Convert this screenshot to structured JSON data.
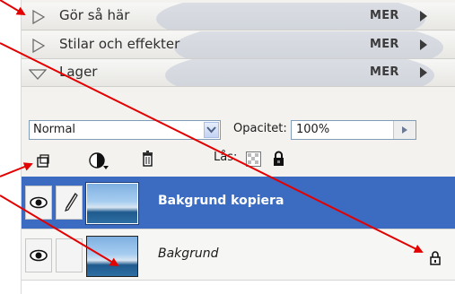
{
  "panels": [
    {
      "title": "Gör så här",
      "more": "MER"
    },
    {
      "title": "Stilar och effekter",
      "more": "MER"
    },
    {
      "title": "Lager",
      "more": "MER"
    }
  ],
  "layer_options": {
    "blend_mode": "Normal",
    "opacity_label": "Opacitet:",
    "opacity_value": "100%",
    "lock_label": "Lås:"
  },
  "layers": [
    {
      "name": "Bakgrund kopiera",
      "selected": true
    },
    {
      "name": "Bakgrund",
      "selected": false
    }
  ],
  "colors": {
    "selection": "#3c6cc2",
    "annotation_arrow": "#e30000"
  }
}
